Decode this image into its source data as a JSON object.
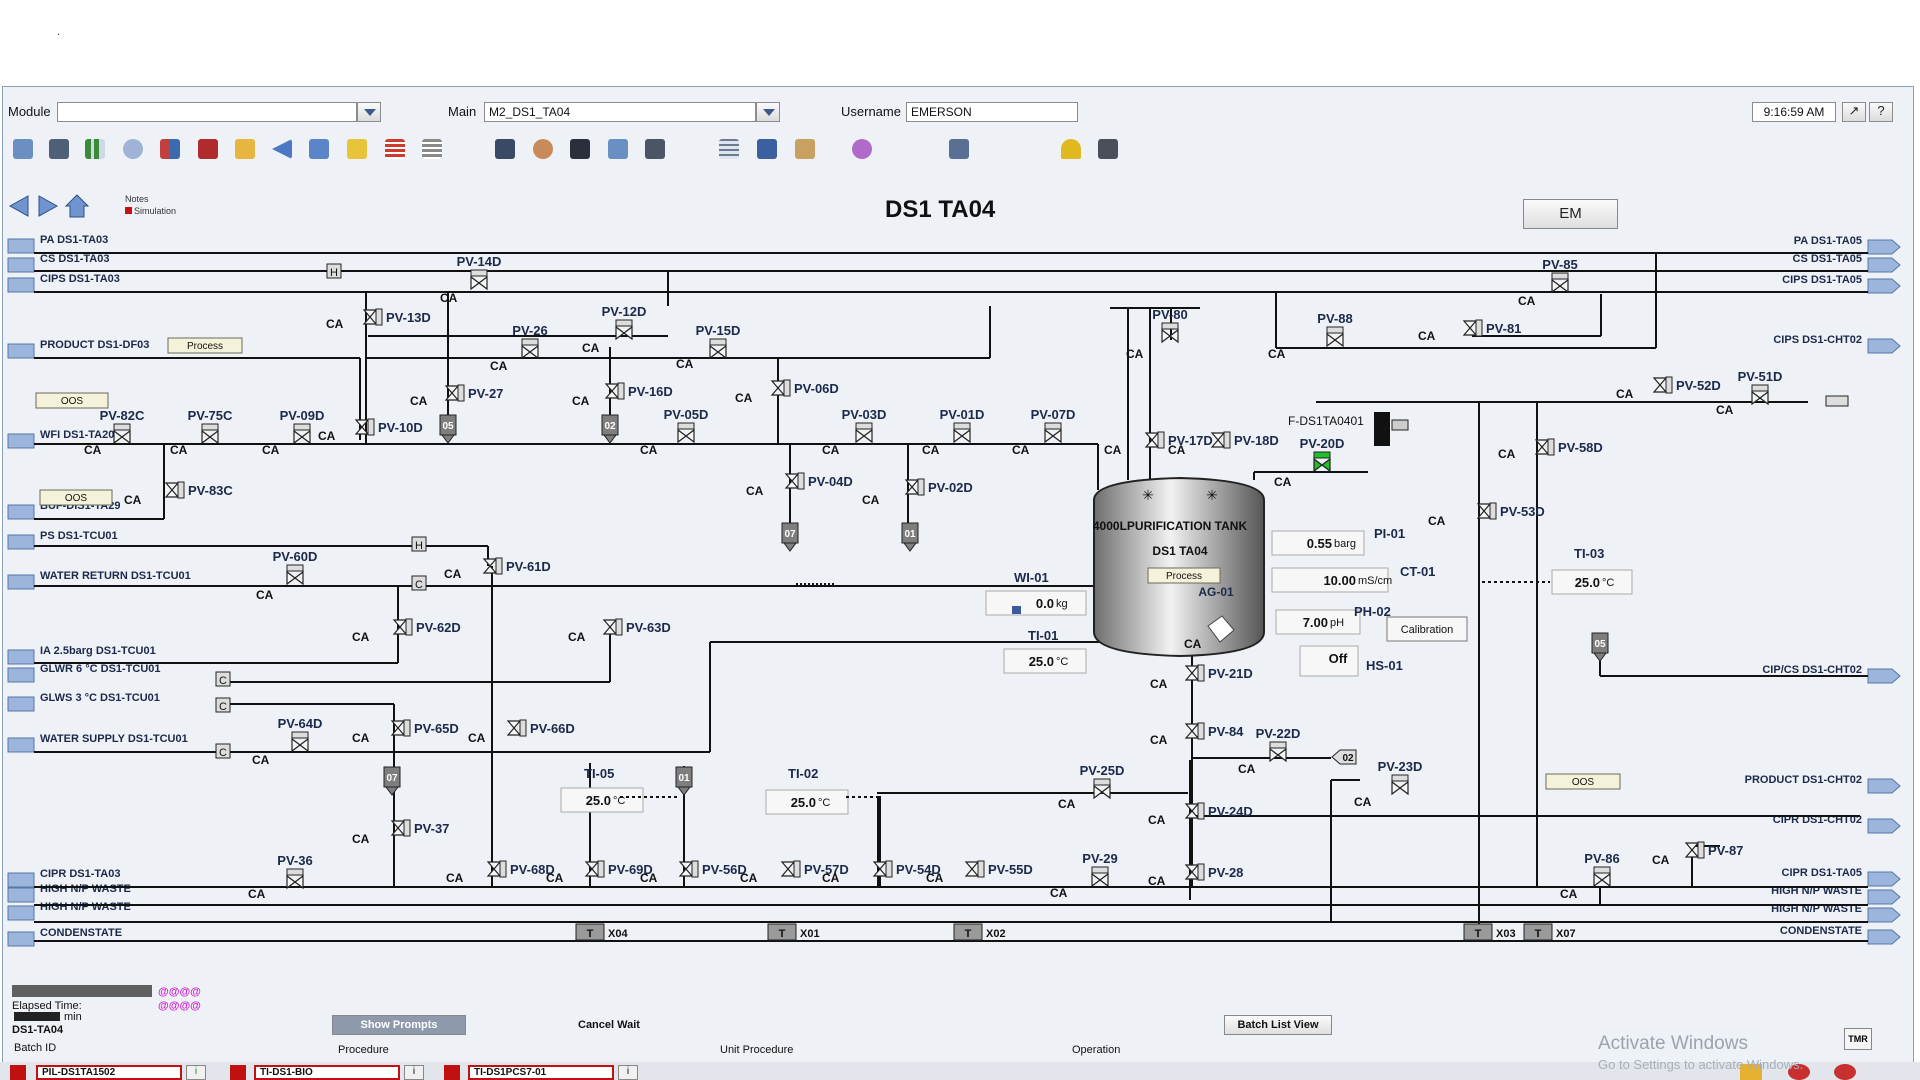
{
  "header": {
    "module_label": "Module",
    "module_value": "",
    "main_label": "Main",
    "main_value": "M2_DS1_TA04",
    "username_label": "Username",
    "username_value": "EMERSON",
    "clock": "9:16:59 AM",
    "help": "?"
  },
  "title": "DS1 TA04",
  "em_button": "EM",
  "notes": {
    "label": "Notes",
    "sim": "Simulation"
  },
  "left_lines": [
    "PA DS1-TA03",
    "CS DS1-TA03",
    "CIPS DS1-TA03",
    "PRODUCT DS1-DF03",
    "WFI DS1-TA20",
    "BUF-DIS1-TA29",
    "PS DS1-TCU01",
    "WATER RETURN DS1-TCU01",
    "IA 2.5barg DS1-TCU01",
    "GLWR 6 °C  DS1-TCU01",
    "GLWS 3 °C  DS1-TCU01",
    "WATER SUPPLY DS1-TCU01",
    "CIPR DS1-TA03",
    "HIGH N/P WASTE",
    "HIGH N/P WASTE",
    "CONDENSTATE"
  ],
  "right_lines": [
    "PA DS1-TA05",
    "CS DS1-TA05",
    "CIPS DS1-TA05",
    "CIPS DS1-CHT02",
    "CIP/CS DS1-CHT02",
    "PRODUCT DS1-CHT02",
    "CIPR DS1-CHT02",
    "CIPR DS1-TA05",
    "HIGH N/P WASTE",
    "HIGH N/P WASTE",
    "CONDENSTATE"
  ],
  "valves": [
    "PV-14D",
    "PV-13D",
    "PV-26",
    "PV-12D",
    "PV-15D",
    "PV-27",
    "PV-16D",
    "PV-06D",
    "PV-10D",
    "PV-82C",
    "PV-75C",
    "PV-09D",
    "PV-05D",
    "PV-03D",
    "PV-01D",
    "PV-07D",
    "PV-83C",
    "PV-04D",
    "PV-02D",
    "PV-80",
    "PV-17D",
    "PV-18D",
    "PV-88",
    "PV-81",
    "PV-85",
    "PV-52D",
    "PV-51D",
    "PV-58D",
    "PV-20D",
    "PV-53D",
    "PV-60D",
    "PV-61D",
    "PV-62D",
    "PV-63D",
    "PV-64D",
    "PV-65D",
    "PV-66D",
    "PV-37",
    "PV-36",
    "PV-68D",
    "PV-69D",
    "PV-56D",
    "PV-57D",
    "PV-54D",
    "PV-55D",
    "PV-29",
    "PV-25D",
    "PV-21D",
    "PV-84",
    "PV-22D",
    "PV-23D",
    "PV-24D",
    "PV-28",
    "PV-86",
    "PV-87"
  ],
  "ca": "CA",
  "process_badge": "Process",
  "oos_badge": "OOS",
  "tank": {
    "name": "4000LPURIFICATION TANK",
    "tag": "DS1 TA04",
    "state": "Process",
    "agitator": "AG-01"
  },
  "instruments": {
    "wi01_tag": "WI-01",
    "wi01_value": "0.0",
    "wi01_unit": "kg",
    "ti01_tag": "TI-01",
    "ti01_value": "25.0",
    "ti01_unit": "°C",
    "pi01_tag": "PI-01",
    "pi01_value": "0.55",
    "pi01_unit": "barg",
    "ct01_tag": "CT-01",
    "ct01_value": "10.00",
    "ct01_unit": "mS/cm",
    "ph02_tag": "PH-02",
    "ph02_value": "7.00",
    "ph02_unit": "pH",
    "hs01_tag": "HS-01",
    "hs01_value": "Off",
    "ti03_tag": "TI-03",
    "ti03_value": "25.0",
    "ti03_unit": "°C",
    "ti05_tag": "TI-05",
    "ti05_value": "25.0",
    "ti05_unit": "°C",
    "ti02_tag": "TI-02",
    "ti02_value": "25.0",
    "ti02_unit": "°C",
    "filter_tag": "F-DS1TA0401",
    "calibration": "Calibration"
  },
  "drain_tags": [
    "05",
    "02",
    "07",
    "01",
    "07",
    "01",
    "02",
    "05"
  ],
  "traps": [
    "X04",
    "X01",
    "X02",
    "X03",
    "X07"
  ],
  "trap_letter": "T",
  "box_h": "H",
  "box_c": "C",
  "footer": {
    "elapsed_label": "Elapsed Time:",
    "elapsed_value": "min",
    "unit": "DS1-TA04",
    "batch_id": "Batch ID",
    "show_prompts": "Show Prompts",
    "cancel_wait": "Cancel Wait",
    "batch_list": "Batch List View",
    "procedure": "Procedure",
    "unit_procedure": "Unit Procedure",
    "operation": "Operation",
    "dots": "@@@@",
    "tmr": "TMR"
  },
  "alarms": [
    "PIL-DS1TA1502",
    "TI-DS1-BIO",
    "TI-DS1PCS7-01"
  ],
  "watermark": {
    "line1": "Activate Windows",
    "line2": "Go to Settings to activate Windows."
  },
  "colors": {
    "pipe": "#111111",
    "label": "#1b2a4a",
    "background": "#eef1f6",
    "alarm": "#c01010",
    "valve_open": "#1fbf2a"
  }
}
